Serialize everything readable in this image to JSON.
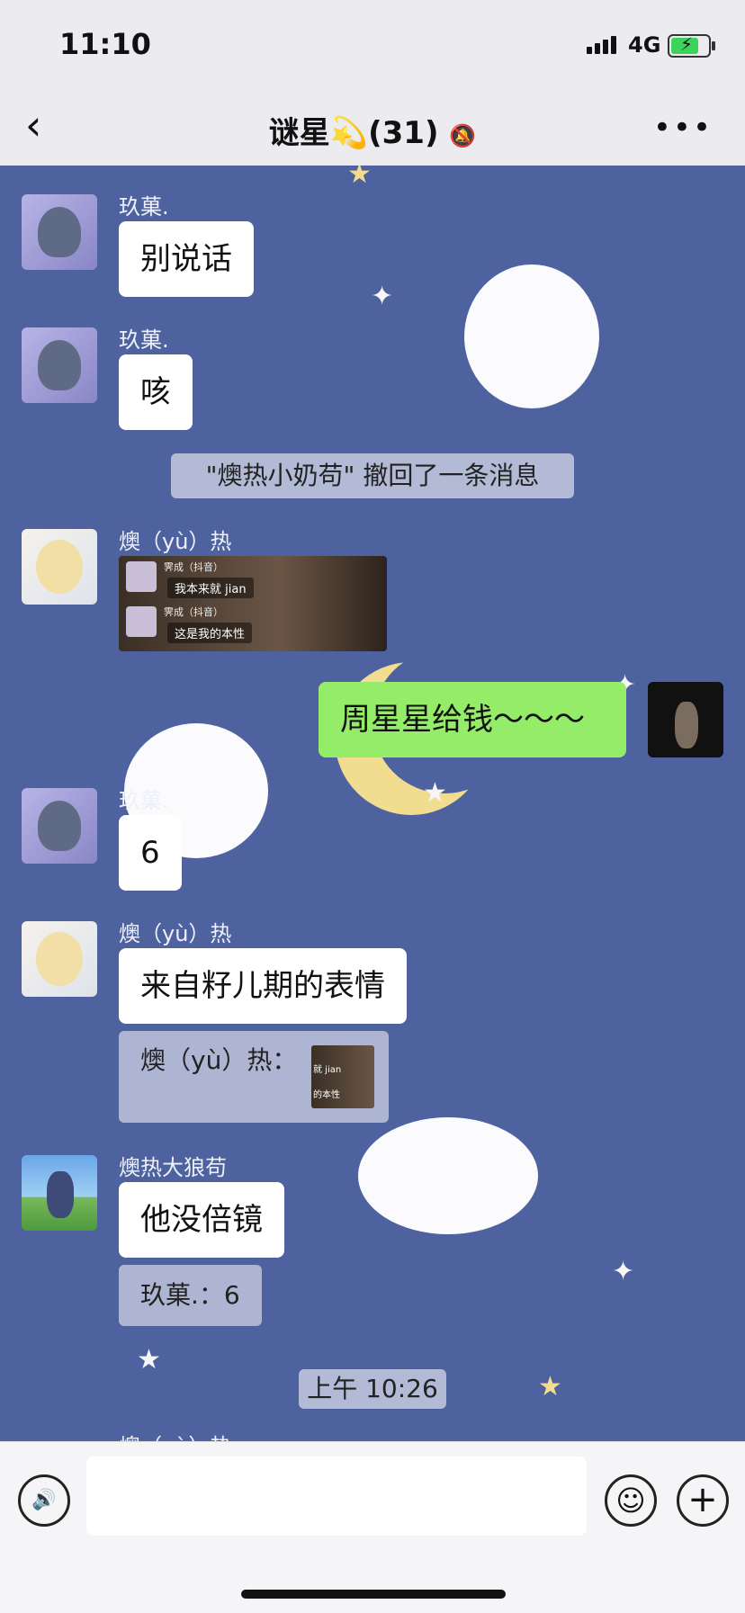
{
  "status_bar": {
    "time": "11:10",
    "network": "4G"
  },
  "header": {
    "back_icon": "chevron-left-icon",
    "title": "谜星💫(31)",
    "mute_icon": "🔕",
    "more": "•••"
  },
  "messages": [
    {
      "sender": "玖菓.",
      "text": "别说话"
    },
    {
      "sender": "玖菓.",
      "text": "咳"
    },
    {
      "system": "\"燠热小奶苟\" 撤回了一条消息"
    },
    {
      "sender": "燠（yù）热",
      "image": {
        "rows": [
          {
            "name": "霁成（抖音）",
            "text": "我本来就 jian"
          },
          {
            "name": "霁成（抖音）",
            "text": "这是我的本性"
          }
        ]
      }
    },
    {
      "self": true,
      "text": "周星星给钱～～～"
    },
    {
      "sender": "玖菓.",
      "text": "6"
    },
    {
      "sender": "燠（yù）热",
      "text": "来自籽儿期的表情",
      "quote": "燠（yù）热：",
      "quote_thumb": [
        "就 jian",
        "的本性"
      ]
    },
    {
      "sender": "燠热大狼苟",
      "text": "他没倍镜",
      "quote": "玖菓.：6"
    },
    {
      "timestamp": "上午 10:26"
    },
    {
      "partial_sender": "燠（yù）热"
    }
  ],
  "input_bar": {
    "voice_icon": "🔊",
    "emoji_icon": "☺",
    "plus_icon": "+"
  },
  "colors": {
    "chat_bg": "#4d629f",
    "self_bubble": "#95ec69",
    "battery": "#3bd35a"
  }
}
